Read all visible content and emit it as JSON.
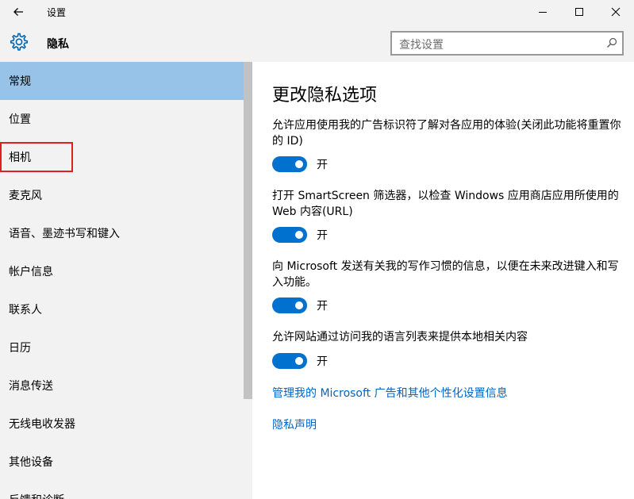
{
  "window": {
    "title": "设置"
  },
  "header": {
    "title": "隐私",
    "search_placeholder": "查找设置"
  },
  "sidebar": {
    "items": [
      {
        "label": "常规"
      },
      {
        "label": "位置"
      },
      {
        "label": "相机"
      },
      {
        "label": "麦克风"
      },
      {
        "label": "语音、墨迹书写和键入"
      },
      {
        "label": "帐户信息"
      },
      {
        "label": "联系人"
      },
      {
        "label": "日历"
      },
      {
        "label": "消息传送"
      },
      {
        "label": "无线电收发器"
      },
      {
        "label": "其他设备"
      },
      {
        "label": "反馈和诊断"
      }
    ],
    "active_index": 0
  },
  "main": {
    "title": "更改隐私选项",
    "options": [
      {
        "text": "允许应用使用我的广告标识符了解对各应用的体验(关闭此功能将重置你的 ID)",
        "state": "开"
      },
      {
        "text": "打开 SmartScreen 筛选器，以检查 Windows 应用商店应用所使用的 Web 内容(URL)",
        "state": "开"
      },
      {
        "text": "向 Microsoft 发送有关我的写作习惯的信息，以便在未来改进键入和写入功能。",
        "state": "开"
      },
      {
        "text": "允许网站通过访问我的语言列表来提供本地相关内容",
        "state": "开"
      }
    ],
    "links": [
      {
        "label": "管理我的 Microsoft 广告和其他个性化设置信息"
      },
      {
        "label": "隐私声明"
      }
    ]
  },
  "colors": {
    "accent": "#0071cf",
    "active_nav": "#97c3e9",
    "link": "#0064c8",
    "highlight": "#e02020"
  }
}
